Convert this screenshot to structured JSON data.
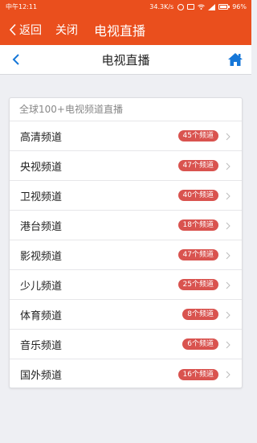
{
  "status_bar": {
    "time": "中午12:11",
    "network_speed": "34.3K/s",
    "battery_percent": "96%"
  },
  "app_bar": {
    "back_label": "返回",
    "close_label": "关闭",
    "title": "电视直播",
    "background_color": "#ea4f1d"
  },
  "nav": {
    "title": "电视直播",
    "home_icon": "home-icon",
    "home_icon_color": "#1677d8"
  },
  "card": {
    "header": "全球100+电视频道直播",
    "badge_color": "#d9534f",
    "channels": [
      {
        "name": "高清频道",
        "count": "45个频道"
      },
      {
        "name": "央视频道",
        "count": "47个频道"
      },
      {
        "name": "卫视频道",
        "count": "40个频道"
      },
      {
        "name": "港台频道",
        "count": "18个频道"
      },
      {
        "name": "影视频道",
        "count": "47个频道"
      },
      {
        "name": "少儿频道",
        "count": "25个频道"
      },
      {
        "name": "体育频道",
        "count": "8个频道"
      },
      {
        "name": "音乐频道",
        "count": "6个频道"
      },
      {
        "name": "国外频道",
        "count": "16个频道"
      }
    ]
  }
}
